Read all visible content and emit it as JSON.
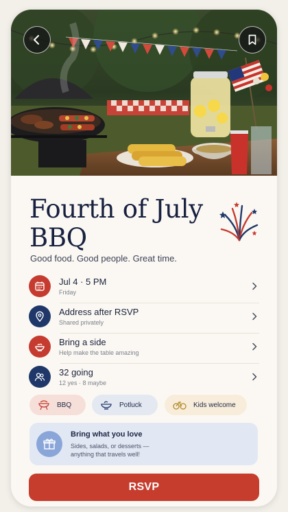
{
  "event": {
    "title": "Fourth of July BBQ",
    "tagline": "Good food. Good people. Great time."
  },
  "details": [
    {
      "icon": "calendar-icon",
      "main": "Jul 4 · 5 PM",
      "sub": "Friday"
    },
    {
      "icon": "location-pin-icon",
      "main": "Address after RSVP",
      "sub": "Shared privately"
    },
    {
      "icon": "bowl-icon",
      "main": "Bring a side",
      "sub": "Help make the table amazing"
    },
    {
      "icon": "people-icon",
      "main": "32 going",
      "sub": "12 yes · 8 maybe"
    }
  ],
  "tags": [
    {
      "icon": "grill-icon",
      "label": "BBQ"
    },
    {
      "icon": "bowl-icon",
      "label": "Potluck"
    },
    {
      "icon": "bicycle-icon",
      "label": "Kids welcome"
    }
  ],
  "banner": {
    "icon": "gift-icon",
    "heading": "Bring what you love",
    "text": "Sides, salads, or desserts — anything that travels well!"
  },
  "rsvp_label": "RSVP",
  "colors": {
    "accent_red": "#c63d2e",
    "navy": "#1f3869",
    "background": "#fbf8f3"
  }
}
